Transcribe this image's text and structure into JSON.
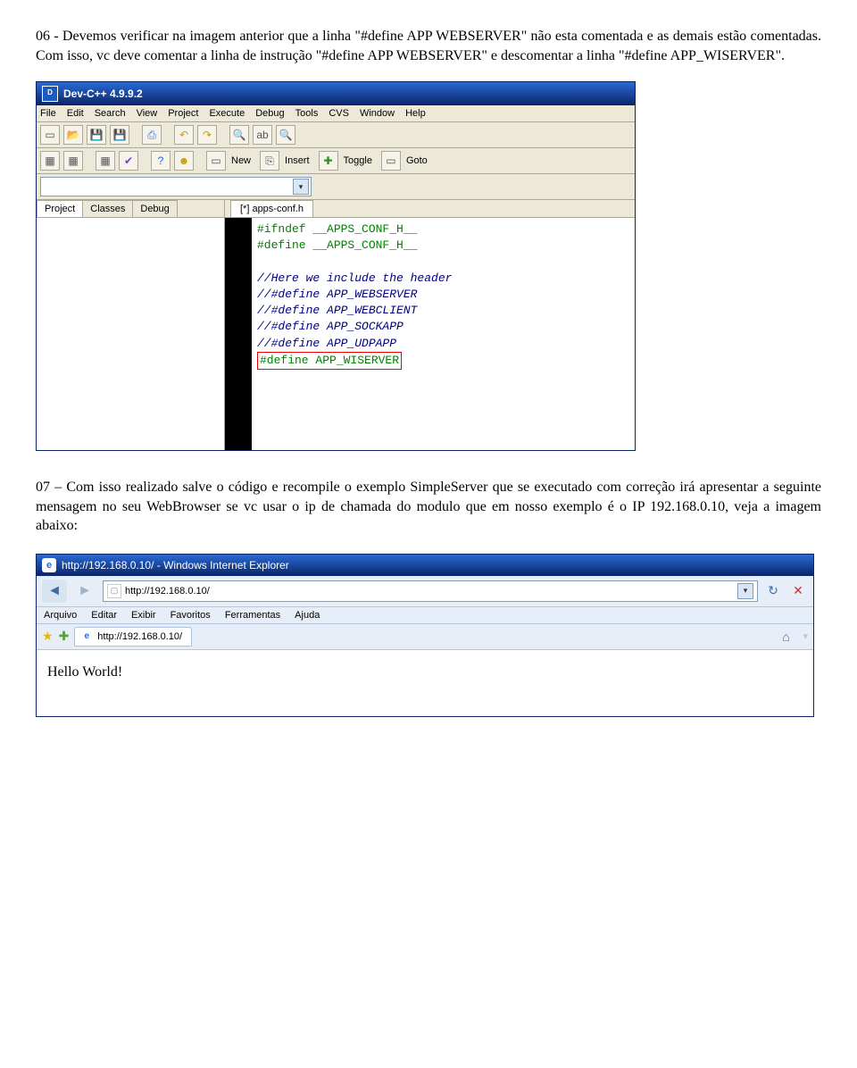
{
  "para1": "06 - Devemos verificar na imagem anterior que a linha \"#define APP WEBSERVER\" não esta comentada e as demais estão comentadas. Com isso, vc deve comentar a linha de instrução \"#define APP WEBSERVER\" e descomentar a linha \"#define APP_WISERVER\".",
  "devcpp": {
    "title": "Dev-C++ 4.9.9.2",
    "menus": [
      "File",
      "Edit",
      "Search",
      "View",
      "Project",
      "Execute",
      "Debug",
      "Tools",
      "CVS",
      "Window",
      "Help"
    ],
    "toolbar2": {
      "new": "New",
      "insert": "Insert",
      "toggle": "Toggle",
      "goto": "Goto"
    },
    "lefttabs": [
      "Project",
      "Classes",
      "Debug"
    ],
    "filetab": "[*] apps-conf.h",
    "code": {
      "l1": "#ifndef __APPS_CONF_H__",
      "l2": "#define __APPS_CONF_H__",
      "l3": "",
      "l4": "//Here we include the header",
      "l5": "//#define APP_WEBSERVER",
      "l6": "//#define APP_WEBCLIENT",
      "l7": "//#define APP_SOCKAPP",
      "l8": "//#define APP_UDPAPP",
      "l9": "#define APP_WISERVER"
    }
  },
  "para2": "07 – Com isso realizado salve o código e recompile o exemplo SimpleServer que se executado com correção irá apresentar a seguinte mensagem no seu WebBrowser se vc usar o ip de chamada do modulo que em nosso exemplo é o IP 192.168.0.10, veja a imagem abaixo:",
  "ie": {
    "title": "http://192.168.0.10/ - Windows Internet Explorer",
    "url": "http://192.168.0.10/",
    "menus": [
      "Arquivo",
      "Editar",
      "Exibir",
      "Favoritos",
      "Ferramentas",
      "Ajuda"
    ],
    "tabtitle": "http://192.168.0.10/",
    "content": "Hello World!"
  },
  "icons": {
    "back": "◄",
    "fwd": "►",
    "refresh": "↻",
    "stop": "✕",
    "search": "🔍",
    "dropdown": "▾",
    "star": "★",
    "plus": "✚",
    "home": "⌂",
    "print": "⎙",
    "page": "▤",
    "tools": "⚙",
    "check": "✔",
    "question": "?",
    "face": "☻",
    "undo": "↶",
    "redo": "↷",
    "grid": "▦",
    "doc": "▭"
  }
}
